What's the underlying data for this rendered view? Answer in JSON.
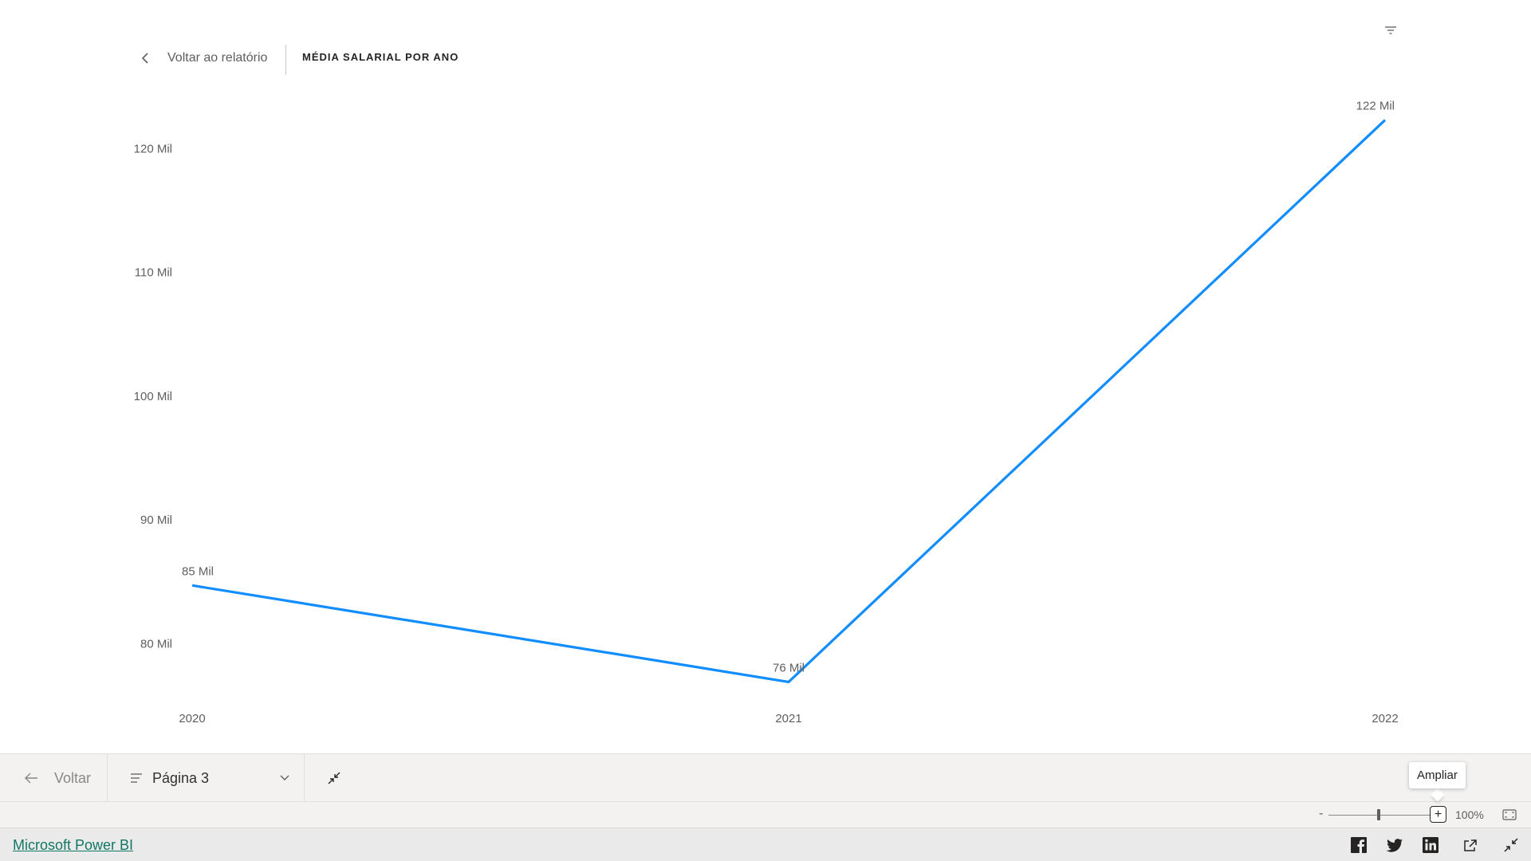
{
  "header": {
    "back_label": "Voltar ao relatório",
    "visual_title": "MÉDIA SALARIAL POR ANO"
  },
  "chart_data": {
    "type": "line",
    "title": "MÉDIA SALARIAL POR ANO",
    "categories": [
      "2020",
      "2021",
      "2022"
    ],
    "series": [
      {
        "values": [
          84700,
          76900,
          122300
        ],
        "labels": [
          "85 Mil",
          "76 Mil",
          "122 Mil"
        ]
      }
    ],
    "y_ticks": [
      80000,
      90000,
      100000,
      110000,
      120000
    ],
    "y_tick_labels": [
      "80 Mil",
      "90 Mil",
      "100 Mil",
      "110 Mil",
      "120 Mil"
    ],
    "ylim": [
      76000,
      122500
    ],
    "color": "#118DFF",
    "grid": false
  },
  "navbar": {
    "back_label": "Voltar",
    "page_label": "Página 3"
  },
  "zoom": {
    "minus": "-",
    "plus": "+",
    "percent": "100%",
    "tooltip": "Ampliar"
  },
  "footer": {
    "brand": "Microsoft Power BI"
  },
  "colors": {
    "line": "#118DFF",
    "brand_link": "#117865"
  }
}
